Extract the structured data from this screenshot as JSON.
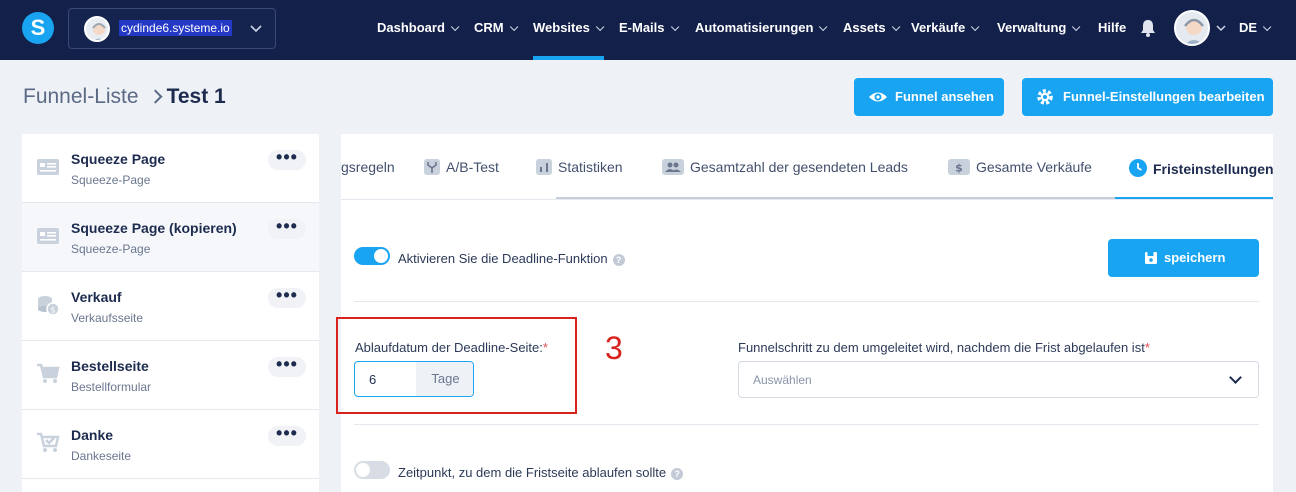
{
  "topbar": {
    "logo": "S",
    "account_name": "cydinde6.systeme.io",
    "nav": [
      "Dashboard",
      "CRM",
      "Websites",
      "E-Mails",
      "Automatisierungen",
      "Assets",
      "Verkäufe",
      "Verwaltung",
      "Hilfe"
    ],
    "language": "DE",
    "active_nav": "Websites",
    "colors": {
      "bg": "#13204a",
      "accent": "#19a4f2"
    }
  },
  "header": {
    "breadcrumb_parent": "Funnel-Liste",
    "breadcrumb_current": "Test 1",
    "view_button": "Funnel ansehen",
    "settings_button": "Funnel-Einstellungen bearbeiten"
  },
  "sidebar": {
    "items": [
      {
        "title": "Squeeze Page",
        "subtitle": "Squeeze-Page",
        "icon": "page-layout-icon"
      },
      {
        "title": "Squeeze Page (kopieren)",
        "subtitle": "Squeeze-Page",
        "icon": "page-layout-icon"
      },
      {
        "title": "Verkauf",
        "subtitle": "Verkaufsseite",
        "icon": "coins-icon"
      },
      {
        "title": "Bestellseite",
        "subtitle": "Bestellformular",
        "icon": "cart-icon"
      },
      {
        "title": "Danke",
        "subtitle": "Dankeseite",
        "icon": "cart-check-icon"
      }
    ],
    "more_label": "•••"
  },
  "tabs": [
    {
      "label": "gsregeln",
      "icon": ""
    },
    {
      "label": "A/B-Test",
      "icon": "split-icon"
    },
    {
      "label": "Statistiken",
      "icon": "chart-icon"
    },
    {
      "label": "Gesamtzahl der gesendeten Leads",
      "icon": "users-icon"
    },
    {
      "label": "Gesamte Verkäufe",
      "icon": "dollar-icon"
    },
    {
      "label": "Fristeinstellungen",
      "icon": "clock-icon"
    }
  ],
  "deadline": {
    "enable_label": "Aktivieren Sie die Deadline-Funktion",
    "enabled": true,
    "save_button": "speichern",
    "expiry_label": "Ablaufdatum der Deadline-Seite:",
    "required_mark": "*",
    "expiry_value": "6",
    "expiry_unit": "Tage",
    "redirect_label": "Funnelschritt zu dem umgeleitet wird, nachdem die Frist abgelaufen ist",
    "redirect_placeholder": "Auswählen",
    "time_label": "Zeitpunkt, zu dem die Fristseite ablaufen sollte",
    "time_enabled": false,
    "help_mark": "?"
  },
  "annotation": {
    "step_number": "3",
    "color": "#d9221c"
  }
}
